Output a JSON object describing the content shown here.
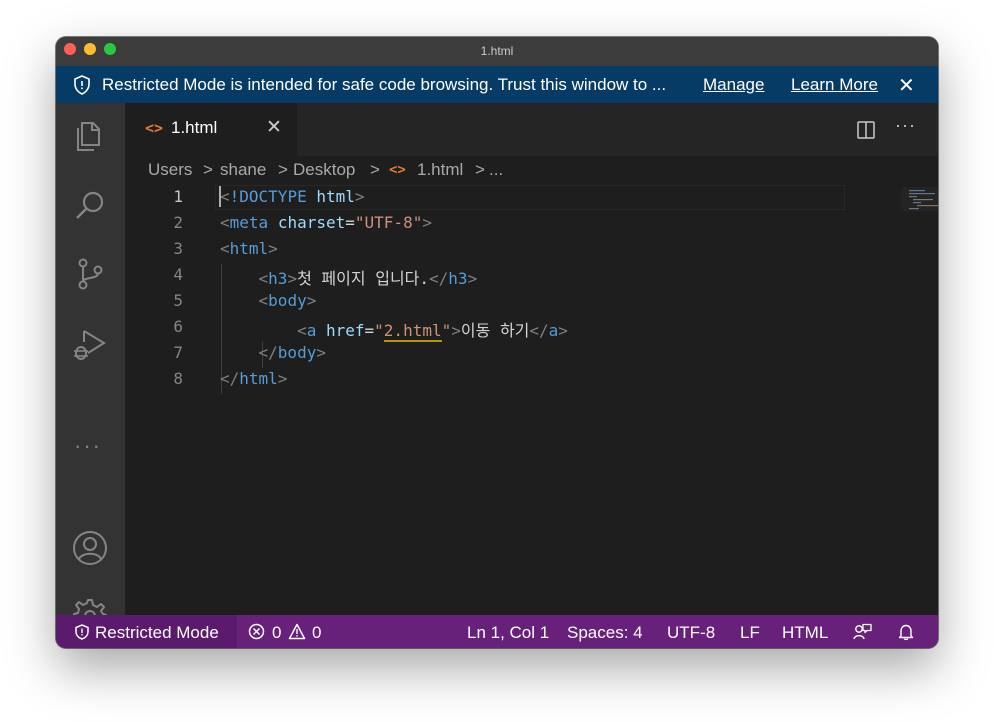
{
  "window": {
    "title": "1.html"
  },
  "banner": {
    "message": "Restricted Mode is intended for safe code browsing. Trust this window to ...",
    "manage_label": "Manage",
    "learn_more_label": "Learn More",
    "close_glyph": "✕"
  },
  "activity_bar": {
    "items": [
      {
        "name": "explorer-icon"
      },
      {
        "name": "search-icon"
      },
      {
        "name": "source-control-icon"
      },
      {
        "name": "run-debug-icon"
      },
      {
        "name": "more-icon",
        "glyph": "···"
      },
      {
        "name": "account-icon"
      },
      {
        "name": "manage-gear-icon"
      }
    ]
  },
  "tabs": [
    {
      "icon": "<>",
      "label": "1.html",
      "close_glyph": "✕",
      "active": true
    }
  ],
  "editor_actions": {
    "more_glyph": "···"
  },
  "breadcrumb": {
    "items": [
      "Users",
      "shane",
      "Desktop",
      "1.html",
      "..."
    ],
    "separator": ">",
    "file_icon": "<>"
  },
  "code_lines": [
    {
      "number": "1"
    },
    {
      "number": "2"
    },
    {
      "number": "3"
    },
    {
      "number": "4"
    },
    {
      "number": "5"
    },
    {
      "number": "6"
    },
    {
      "number": "7"
    },
    {
      "number": "8"
    }
  ],
  "tokens": {
    "lt": "<",
    "gt": ">",
    "lt_slash": "</",
    "eq": "=",
    "quote": "\"",
    "doctype": "!DOCTYPE",
    "html_kw": "html",
    "meta": "meta",
    "charset": "charset",
    "utf8": "UTF-8",
    "html": "html",
    "h3": "h3",
    "h3_text": "첫 페이지 입니다.",
    "body": "body",
    "a": "a",
    "href": "href",
    "href_val": "2.html",
    "a_text": "이동 하기"
  },
  "statusbar": {
    "restricted_label": "Restricted Mode",
    "errors": "0",
    "warnings": "0",
    "position": "Ln 1, Col 1",
    "spaces": "Spaces: 4",
    "encoding": "UTF-8",
    "eol": "LF",
    "language": "HTML"
  },
  "colors": {
    "banner": "#063b66",
    "statusbar": "#68217a",
    "tag": "#569cd6",
    "attribute": "#9cdcfe",
    "string": "#ce9178"
  }
}
